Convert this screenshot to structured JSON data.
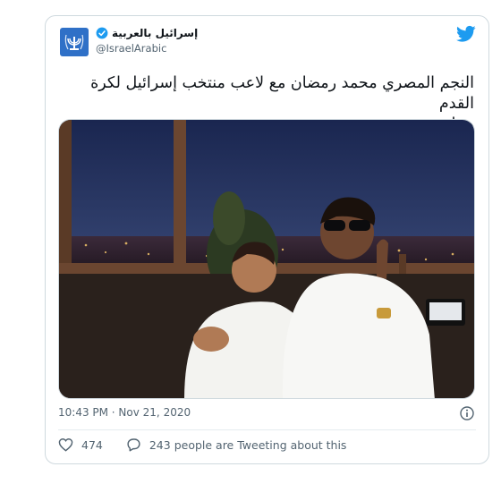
{
  "tweet": {
    "display_name": "إسرائيل بالعربية",
    "handle": "@IsraelArabic",
    "text_line1": "النجم المصري محمد رمضان مع لاعب منتخب إسرائيل لكرة القدم",
    "text_line2": "ضياء سبع في دبي",
    "flags": [
      "israel-flag-icon",
      "egypt-flag-icon"
    ],
    "timestamp": "10:43 PM · Nov 21, 2020",
    "like_count": "474",
    "retweet_text": "243 people are Tweeting about this"
  },
  "colors": {
    "twitter_blue": "#1d9bf0",
    "avatar_blue": "#2f70c7",
    "text_primary": "#0f1419",
    "text_secondary": "#536471",
    "border": "#cfd9de"
  },
  "icons": [
    "israel-emblem-icon",
    "verified-badge-icon",
    "twitter-bird-icon",
    "info-icon",
    "heart-icon",
    "comment-icon"
  ]
}
